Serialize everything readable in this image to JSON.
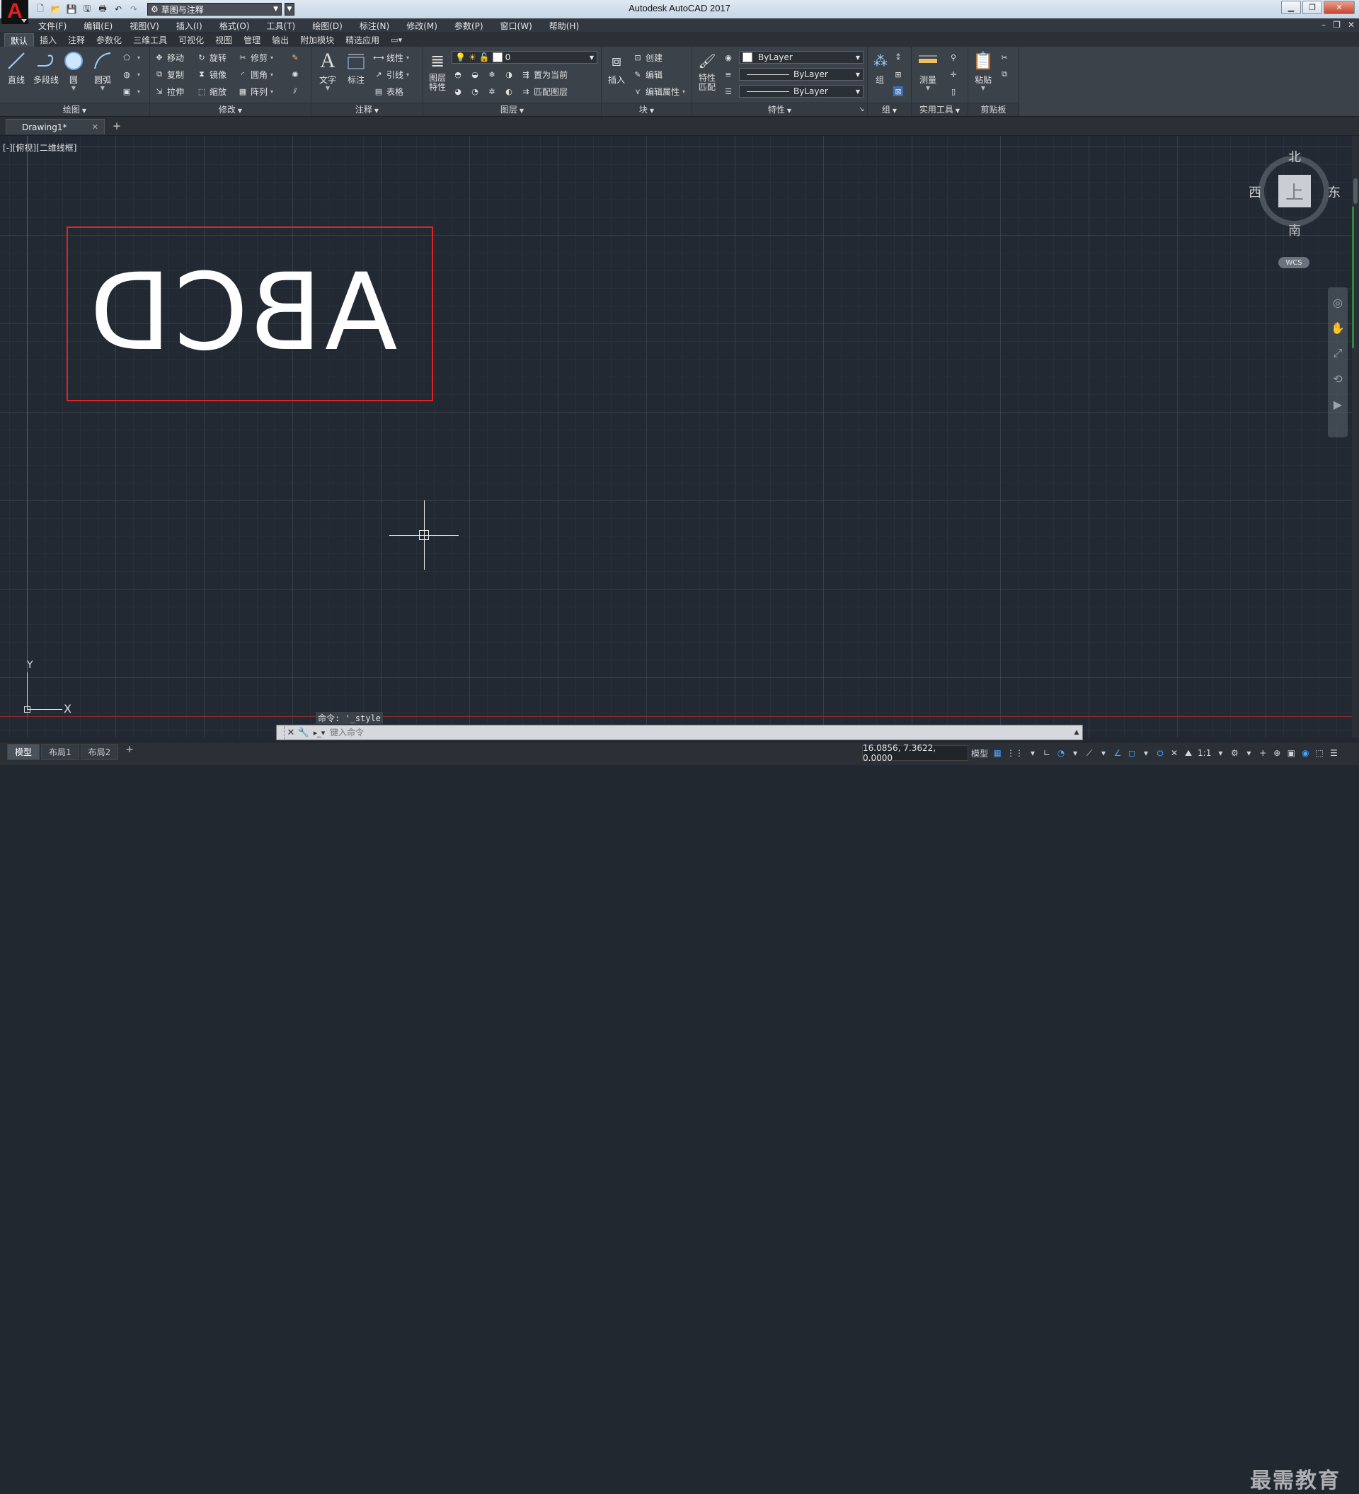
{
  "app": {
    "title": "Autodesk AutoCAD 2017",
    "logo": "A",
    "workspace": "草图与注释"
  },
  "menu": [
    "文件(F)",
    "编辑(E)",
    "视图(V)",
    "插入(I)",
    "格式(O)",
    "工具(T)",
    "绘图(D)",
    "标注(N)",
    "修改(M)",
    "参数(P)",
    "窗口(W)",
    "帮助(H)"
  ],
  "ribbon_tabs": [
    "默认",
    "插入",
    "注释",
    "参数化",
    "三维工具",
    "可视化",
    "视图",
    "管理",
    "输出",
    "附加模块",
    "精选应用"
  ],
  "panels": {
    "draw": {
      "title": "绘图",
      "line": "直线",
      "polyline": "多段线",
      "circle": "圆",
      "arc": "圆弧"
    },
    "modify": {
      "title": "修改",
      "move": "移动",
      "rotate": "旋转",
      "trim": "修剪",
      "copy": "复制",
      "mirror": "镜像",
      "fillet": "圆角",
      "stretch": "拉伸",
      "scale": "缩放",
      "array": "阵列"
    },
    "annotation": {
      "title": "注释",
      "text": "文字",
      "dimension": "标注",
      "linear": "线性",
      "leader": "引线",
      "table": "表格"
    },
    "layers": {
      "title": "图层",
      "layer_props_1": "图层",
      "layer_props_2": "特性",
      "current_layer": "0",
      "set_current": "置为当前",
      "match_layer": "匹配图层"
    },
    "block": {
      "title": "块",
      "insert": "插入",
      "create": "创建",
      "edit": "编辑",
      "edit_attr": "编辑属性"
    },
    "properties": {
      "title": "特性",
      "match_1": "特性",
      "match_2": "匹配",
      "color": "ByLayer",
      "linetype": "ByLayer",
      "lineweight": "ByLayer"
    },
    "groups": {
      "title": "组",
      "group": "组"
    },
    "utilities": {
      "title": "实用工具",
      "measure": "测量"
    },
    "clipboard": {
      "title": "剪贴板",
      "paste": "粘贴"
    }
  },
  "file_tab": {
    "name": "Drawing1*"
  },
  "viewport": {
    "label": "[-][俯视][二维线框]"
  },
  "drawing": {
    "text": "ABCD",
    "text_mirrored": true,
    "frame_color": "#e02424"
  },
  "ucs": {
    "x": "X",
    "y": "Y"
  },
  "viewcube": {
    "north": "北",
    "south": "南",
    "east": "东",
    "west": "西",
    "face": "上",
    "wcs": "WCS"
  },
  "command": {
    "history": "命令: '_style",
    "placeholder": "键入命令"
  },
  "layout_tabs": [
    "模型",
    "布局1",
    "布局2"
  ],
  "status": {
    "coords": "16.0856, 7.3622, 0.0000",
    "mode": "模型",
    "scale": "1:1"
  },
  "watermark": "最需教育"
}
